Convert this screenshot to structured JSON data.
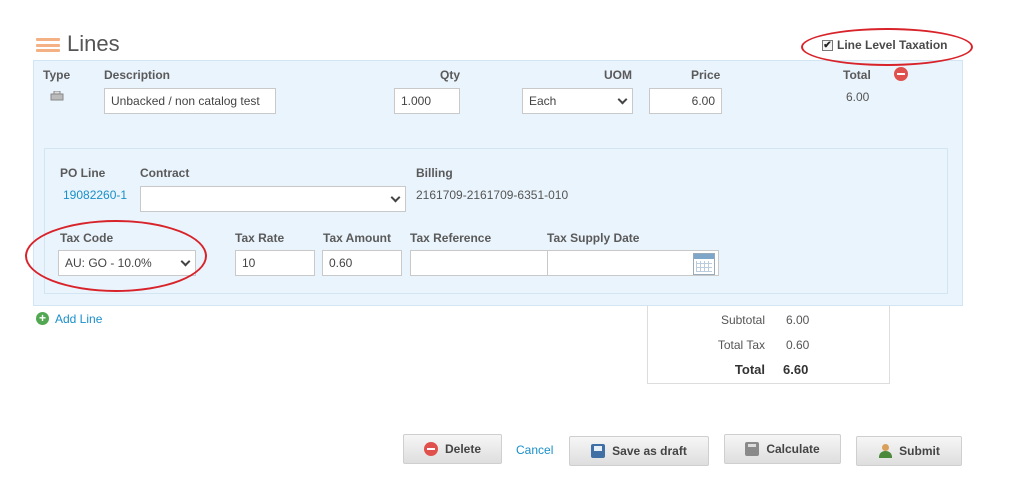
{
  "header": {
    "title": "Lines",
    "line_level_taxation_label": "Line Level Taxation",
    "line_level_taxation_checked": true
  },
  "columns": {
    "type": "Type",
    "description": "Description",
    "qty": "Qty",
    "uom": "UOM",
    "price": "Price",
    "total": "Total"
  },
  "line": {
    "description": "Unbacked / non catalog test",
    "qty": "1.000",
    "uom": "Each",
    "price": "6.00",
    "total": "6.00"
  },
  "details": {
    "po_line_label": "PO Line",
    "po_line_value": "19082260-1",
    "contract_label": "Contract",
    "contract_value": "",
    "billing_label": "Billing",
    "billing_value": "2161709-2161709-6351-010",
    "tax_code_label": "Tax Code",
    "tax_code_value": "AU: GO - 10.0%",
    "tax_rate_label": "Tax Rate",
    "tax_rate_value": "10",
    "tax_amount_label": "Tax Amount",
    "tax_amount_value": "0.60",
    "tax_reference_label": "Tax Reference",
    "tax_reference_value": "",
    "tax_supply_date_label": "Tax Supply Date",
    "tax_supply_date_value": ""
  },
  "add_line_label": "Add Line",
  "totals": {
    "subtotal_label": "Subtotal",
    "subtotal_value": "6.00",
    "total_tax_label": "Total Tax",
    "total_tax_value": "0.60",
    "total_label": "Total",
    "total_value": "6.60"
  },
  "actions": {
    "delete": "Delete",
    "cancel": "Cancel",
    "save_as_draft": "Save as draft",
    "calculate": "Calculate",
    "submit": "Submit"
  },
  "colors": {
    "accent_link": "#1a8fc9",
    "annotation_red": "#d8232a",
    "panel_bg": "#eaf4fc"
  },
  "icons": [
    "lines-icon",
    "checkbox-icon",
    "cart-icon",
    "remove-line-icon",
    "calendar-icon",
    "add-circle-icon",
    "delete-icon",
    "save-icon",
    "calculator-icon",
    "submit-user-icon",
    "chevron-down-icon"
  ]
}
